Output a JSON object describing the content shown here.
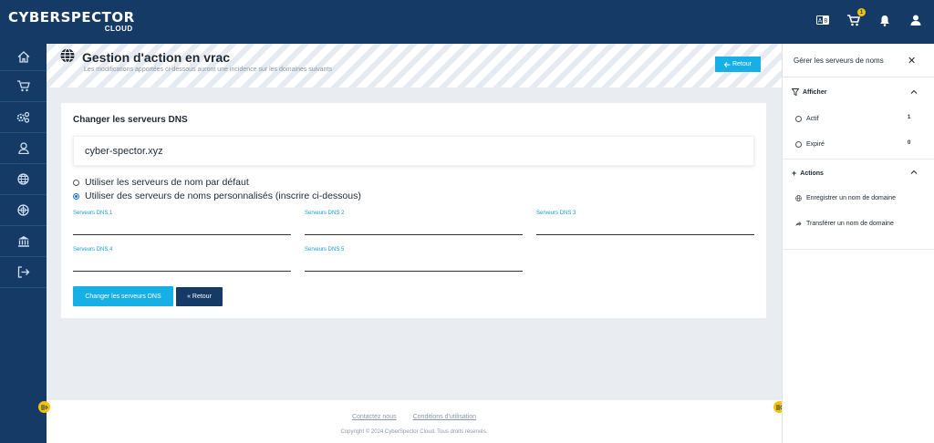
{
  "brand": {
    "name": "CYBERSPECTOR",
    "sub": "CLOUD"
  },
  "topbar": {
    "cart_count": "1",
    "icons": [
      "language-icon",
      "cart-icon",
      "bell-icon",
      "user-icon"
    ]
  },
  "sidebar": {
    "icons": [
      "home-icon",
      "cart-icon",
      "gears-icon",
      "user-icon",
      "globe-icon",
      "network-globe-icon",
      "bank-icon",
      "logout-icon"
    ]
  },
  "header": {
    "title": "Gestion d'action en vrac",
    "subtitle": "Les modifications apportées ci-dessous auront une incidence sur les domaines suivants",
    "back_label": "Retour"
  },
  "card": {
    "title": "Changer les serveurs DNS",
    "domain": "cyber-spector.xyz",
    "options": [
      {
        "label": "Utiliser les serveurs de nom par défaut",
        "checked": false
      },
      {
        "label": "Utiliser des serveurs de noms personnalisés (inscrire ci-dessous)",
        "checked": true
      }
    ],
    "fields": [
      {
        "label": "Serveurs DNS 1",
        "value": ""
      },
      {
        "label": "Serveurs DNS 2",
        "value": ""
      },
      {
        "label": "Serveurs DNS 3",
        "value": ""
      },
      {
        "label": "Serveurs DNS 4",
        "value": ""
      },
      {
        "label": "Serveurs DNS 5",
        "value": ""
      }
    ],
    "submit_label": "Changer les serveurs DNS",
    "back_label": "« Retour"
  },
  "footer": {
    "links": [
      "Contactez nous",
      "Conditions d'utilisation"
    ],
    "copyright": "Copyright © 2024 CyberSpector Cloud. Tous droits réservés."
  },
  "panel": {
    "title": "Gérer les serveurs de noms",
    "filter_title": "Afficher",
    "filters": [
      {
        "label": "Actif",
        "count": "1"
      },
      {
        "label": "Expiré",
        "count": "0"
      }
    ],
    "actions_title": "Actions",
    "actions": [
      {
        "label": "Enregistrer un nom de domaine",
        "icon": "globe-icon"
      },
      {
        "label": "Transférer un nom de domaine",
        "icon": "share-icon"
      }
    ]
  },
  "colors": {
    "navy": "#153a66",
    "accent": "#17b0e6",
    "badge": "#f5c400"
  }
}
